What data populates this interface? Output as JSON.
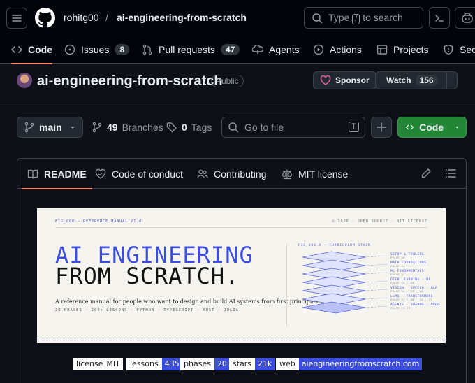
{
  "topbar": {
    "owner": "rohitg00",
    "separator": "/",
    "repo": "ai-engineering-from-scratch",
    "search_before": "Type",
    "search_key": "/",
    "search_after": "to search"
  },
  "nav": {
    "code": "Code",
    "issues": "Issues",
    "issues_count": "8",
    "pull_requests": "Pull requests",
    "pull_requests_count": "47",
    "agents": "Agents",
    "actions": "Actions",
    "projects": "Projects",
    "security": "Sec"
  },
  "repo": {
    "title": "ai-engineering-from-scratch",
    "visibility": "Public",
    "sponsor": "Sponsor",
    "watch": "Watch",
    "watch_count": "156"
  },
  "filenav": {
    "branch": "main",
    "branches_count": "49",
    "branches_label": "Branches",
    "tags_count": "0",
    "tags_label": "Tags",
    "go_to_file": "Go to file",
    "go_to_file_key": "T",
    "code_button": "Code"
  },
  "readme_tabs": {
    "readme": "README",
    "conduct": "Code of conduct",
    "contributing": "Contributing",
    "license": "MIT license"
  },
  "banner": {
    "fig_left": "FIG_000 — REFERENCE MANUAL V1.0",
    "fig_right": "© 2026 · OPEN SOURCE · MIT LICENSE",
    "title_line1": "AI ENGINEERING",
    "title_line2": "FROM SCRATCH.",
    "subtitle": "A reference manual for people who want to design and build AI systems from first principles.",
    "meta": "20 PHASES · 200+ LESSONS · PYTHON · TYPESCRIPT · RUST · JULIA",
    "stack_label": "FIG_000.A — CURRICULUM STACK",
    "stack": [
      {
        "name": "SETUP & TOOLING",
        "phase": "PHASE 00"
      },
      {
        "name": "MATH FOUNDATIONS",
        "phase": "PHASE 01"
      },
      {
        "name": "ML FUNDAMENTALS",
        "phase": "PHASE 02"
      },
      {
        "name": "DEEP LEARNING · NL",
        "phase": "PHASE 03 · 05"
      },
      {
        "name": "VISION · SPEECH · NLP",
        "phase": "PHASE 04 · 05 · 06"
      },
      {
        "name": "LLMS · TRANSFORMERS",
        "phase": "PHASE 07 · 08 · 10 · 11"
      },
      {
        "name": "AGENTS · SWARMS · PROD",
        "phase": "PHASE 13-19"
      }
    ]
  },
  "badges": [
    {
      "key": "license",
      "value": "MIT",
      "color": "#ffffff"
    },
    {
      "key": "lessons",
      "value": "435",
      "color": "#3b4ee0"
    },
    {
      "key": "phases",
      "value": "20",
      "color": "#3b4ee0"
    },
    {
      "key": "stars",
      "value": "21k",
      "color": "#3b4ee0"
    },
    {
      "key": "web",
      "value": "aiengineeringfromscratch.com",
      "color": "#3b4ee0"
    }
  ],
  "colors": {
    "background": "#0d1117",
    "accent_tab": "#f78166",
    "code_button": "#238636",
    "banner_blue": "#3b4ee0"
  }
}
